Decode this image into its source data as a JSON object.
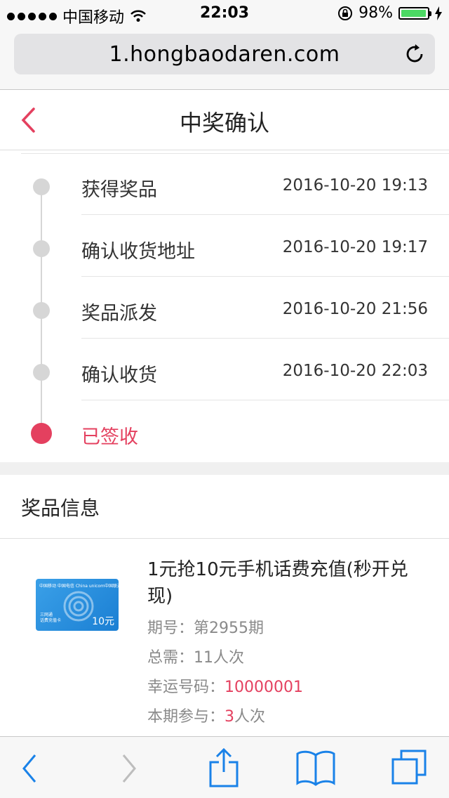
{
  "status_bar": {
    "carrier": "中国移动",
    "time": "22:03",
    "battery_percent": "98%",
    "battery_level": 0.98
  },
  "browser": {
    "url": "1.hongbaodaren.com"
  },
  "header": {
    "title": "中奖确认"
  },
  "timeline": [
    {
      "label": "获得奖品",
      "time": "2016-10-20 19:13"
    },
    {
      "label": "确认收货地址",
      "time": "2016-10-20 19:17"
    },
    {
      "label": "奖品派发",
      "time": "2016-10-20 21:56"
    },
    {
      "label": "确认收货",
      "time": "2016-10-20 22:03"
    },
    {
      "label": "已签收",
      "time": ""
    }
  ],
  "prize": {
    "section_title": "奖品信息",
    "title": "1元抢10元手机话费充值(秒开兑现)",
    "period_label": "期号：",
    "period_value": "第2955期",
    "total_label": "总需：",
    "total_value": "11人次",
    "lucky_label": "幸运号码：",
    "lucky_value": "10000001",
    "participate_label": "本期参与：",
    "participate_count": "3",
    "participate_unit": "人次",
    "card": {
      "amount": "10元",
      "left_text_line1": "三网通",
      "left_text_line2": "话费充值卡",
      "logos": "中国移动  中国电信  China unicom中国联通"
    }
  },
  "colors": {
    "accent": "#e4405f",
    "ios_blue": "#1a82e8",
    "timeline_gray": "#d6d6d6"
  }
}
